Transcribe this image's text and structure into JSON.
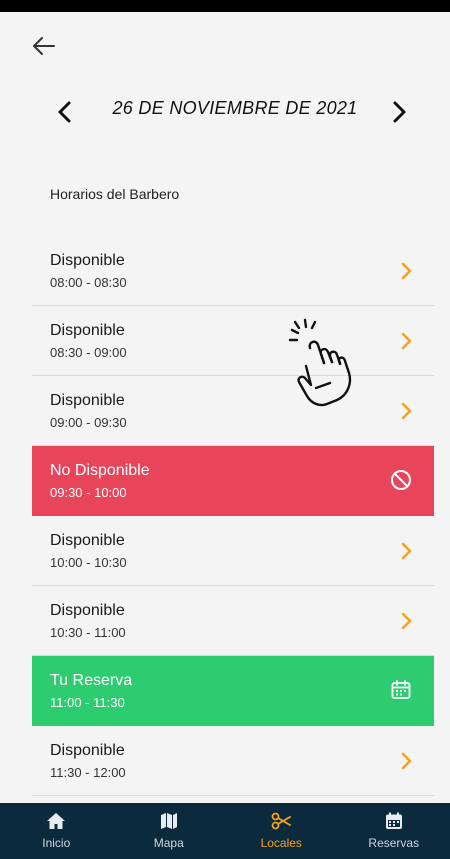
{
  "header": {
    "date_title": "26 DE NOVIEMBRE DE 2021",
    "section_label": "Horarios del Barbero"
  },
  "slots": [
    {
      "title": "Disponible",
      "time": "08:00 - 08:30",
      "status": "available"
    },
    {
      "title": "Disponible",
      "time": "08:30 - 09:00",
      "status": "available"
    },
    {
      "title": "Disponible",
      "time": "09:00 - 09:30",
      "status": "available"
    },
    {
      "title": "No Disponible",
      "time": "09:30 - 10:00",
      "status": "unavailable"
    },
    {
      "title": "Disponible",
      "time": "10:00 - 10:30",
      "status": "available"
    },
    {
      "title": "Disponible",
      "time": "10:30 - 11:00",
      "status": "available"
    },
    {
      "title": "Tu Reserva",
      "time": "11:00 - 11:30",
      "status": "reserved"
    },
    {
      "title": "Disponible",
      "time": "11:30 - 12:00",
      "status": "available"
    }
  ],
  "bottom_nav": [
    {
      "label": "Inicio",
      "icon": "home-icon",
      "active": false
    },
    {
      "label": "Mapa",
      "icon": "map-icon",
      "active": false
    },
    {
      "label": "Locales",
      "icon": "scissors-icon",
      "active": true
    },
    {
      "label": "Reservas",
      "icon": "calendar-icon",
      "active": false
    }
  ],
  "colors": {
    "accent": "#f5a11c",
    "unavailable": "#e8445a",
    "reserved": "#2ecc71",
    "nav_bg": "#0b2a3d",
    "background": "#f4f4f4"
  }
}
